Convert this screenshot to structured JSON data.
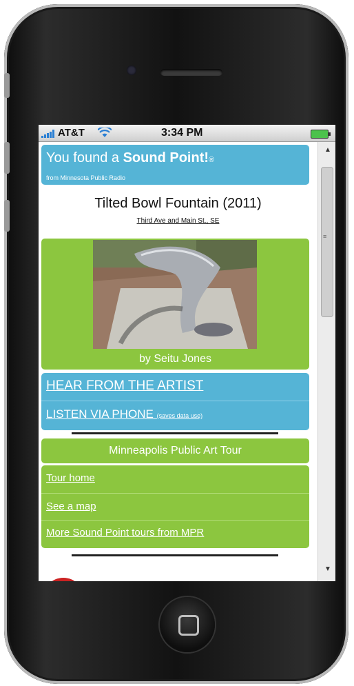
{
  "status_bar": {
    "carrier": "AT&T",
    "time": "3:34 PM"
  },
  "header": {
    "title_prefix": "You found a ",
    "title_bold": "Sound Point!",
    "title_mark": "®",
    "subtitle": "from Minnesota Public Radio"
  },
  "place": {
    "name": "Tilted Bowl Fountain (2011)",
    "address": "Third Ave and Main St., SE"
  },
  "artwork": {
    "artist_credit": "by Seitu Jones"
  },
  "audio": {
    "hear_label": "HEAR FROM THE ARTIST",
    "phone_label": "LISTEN VIA PHONE",
    "phone_note": "(saves data use)"
  },
  "tour": {
    "title": "Minneapolis Public Art Tour",
    "links": [
      "Tour home",
      "See a map",
      "More Sound Point tours from MPR"
    ]
  },
  "colors": {
    "blue_panel": "#55b4d6",
    "green_panel": "#8cc63f"
  },
  "icons": {
    "signal": "signal-bars-icon",
    "wifi": "wifi-icon",
    "battery": "battery-icon",
    "home": "home-button-icon",
    "logo": "mpr-logo-icon"
  }
}
